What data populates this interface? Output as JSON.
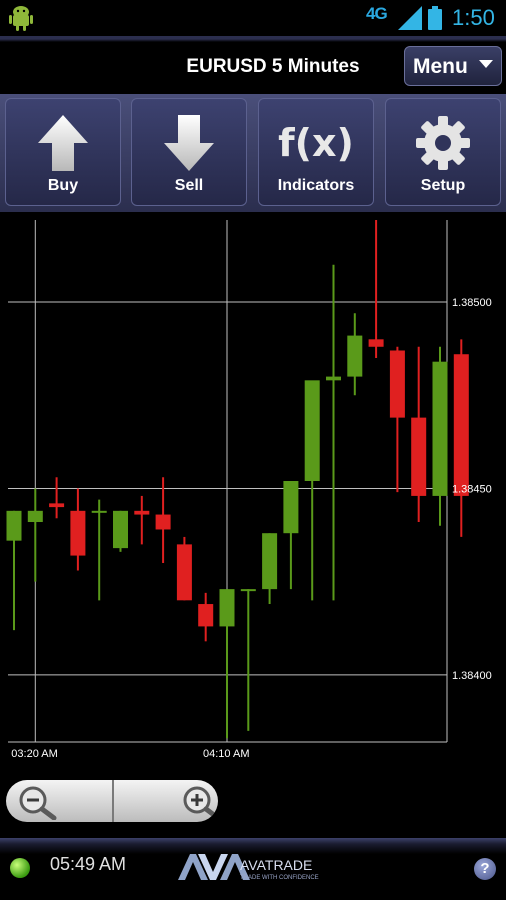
{
  "status_bar": {
    "network": "4G",
    "time": "1:50",
    "icons": [
      "android-icon",
      "signal-icon",
      "battery-icon"
    ]
  },
  "header": {
    "title": "EURUSD 5 Minutes",
    "menu_label": "Menu"
  },
  "toolbar": {
    "buttons": [
      {
        "label": "Buy",
        "icon": "arrow-up-icon"
      },
      {
        "label": "Sell",
        "icon": "arrow-down-icon"
      },
      {
        "label": "Indicators",
        "icon": "fx-icon",
        "icon_text": "f(x)"
      },
      {
        "label": "Setup",
        "icon": "gear-icon"
      }
    ]
  },
  "chart_data": {
    "type": "candlestick",
    "symbol": "EURUSD",
    "ylim": [
      1.38382,
      1.38522
    ],
    "y_ticks": [
      "1.38500",
      "1.38450",
      "1.38400"
    ],
    "x_ticks": [
      {
        "index": 1,
        "label": "03:20 AM"
      },
      {
        "index": 10,
        "label": "04:10 AM"
      }
    ],
    "grid": true,
    "colors": {
      "up": "#5a9a1a",
      "down": "#e02020",
      "grid": "#bfbfbf",
      "background": "#000000"
    },
    "candles": [
      {
        "open": 1.38436,
        "high": 1.38444,
        "low": 1.38412,
        "close": 1.38444
      },
      {
        "open": 1.38441,
        "high": 1.3845,
        "low": 1.38425,
        "close": 1.38444
      },
      {
        "open": 1.38446,
        "high": 1.38453,
        "low": 1.38442,
        "close": 1.38445
      },
      {
        "open": 1.38444,
        "high": 1.3845,
        "low": 1.38428,
        "close": 1.38432
      },
      {
        "open": 1.38444,
        "high": 1.38447,
        "low": 1.3842,
        "close": 1.38444
      },
      {
        "open": 1.38434,
        "high": 1.38444,
        "low": 1.38433,
        "close": 1.38444
      },
      {
        "open": 1.38444,
        "high": 1.38448,
        "low": 1.38435,
        "close": 1.38443
      },
      {
        "open": 1.38443,
        "high": 1.38453,
        "low": 1.3843,
        "close": 1.38439
      },
      {
        "open": 1.38435,
        "high": 1.38437,
        "low": 1.3842,
        "close": 1.3842
      },
      {
        "open": 1.38419,
        "high": 1.38422,
        "low": 1.38409,
        "close": 1.38413
      },
      {
        "open": 1.38413,
        "high": 1.38423,
        "low": 1.38383,
        "close": 1.38423
      },
      {
        "open": 1.38423,
        "high": 1.38423,
        "low": 1.38385,
        "close": 1.38423
      },
      {
        "open": 1.38423,
        "high": 1.38438,
        "low": 1.38419,
        "close": 1.38438
      },
      {
        "open": 1.38438,
        "high": 1.38452,
        "low": 1.38423,
        "close": 1.38452
      },
      {
        "open": 1.38452,
        "high": 1.38465,
        "low": 1.3842,
        "close": 1.38479
      },
      {
        "open": 1.38479,
        "high": 1.3851,
        "low": 1.3842,
        "close": 1.3848
      },
      {
        "open": 1.3848,
        "high": 1.38497,
        "low": 1.38475,
        "close": 1.38491
      },
      {
        "open": 1.3849,
        "high": 1.38522,
        "low": 1.38485,
        "close": 1.38488
      },
      {
        "open": 1.38487,
        "high": 1.38488,
        "low": 1.38449,
        "close": 1.38469
      },
      {
        "open": 1.38469,
        "high": 1.38488,
        "low": 1.38441,
        "close": 1.38448
      },
      {
        "open": 1.38448,
        "high": 1.38488,
        "low": 1.3844,
        "close": 1.38484
      },
      {
        "open": 1.38486,
        "high": 1.3849,
        "low": 1.38437,
        "close": 1.38448
      }
    ]
  },
  "zoom": {
    "out_icon": "zoom-out-icon",
    "in_icon": "zoom-in-icon"
  },
  "footer": {
    "connection_color": "#4cc020",
    "time": "05:49 AM",
    "brand": "AVATRADE",
    "tagline": "TRADE WITH CONFIDENCE",
    "help_icon": "help-icon",
    "help_glyph": "?"
  }
}
